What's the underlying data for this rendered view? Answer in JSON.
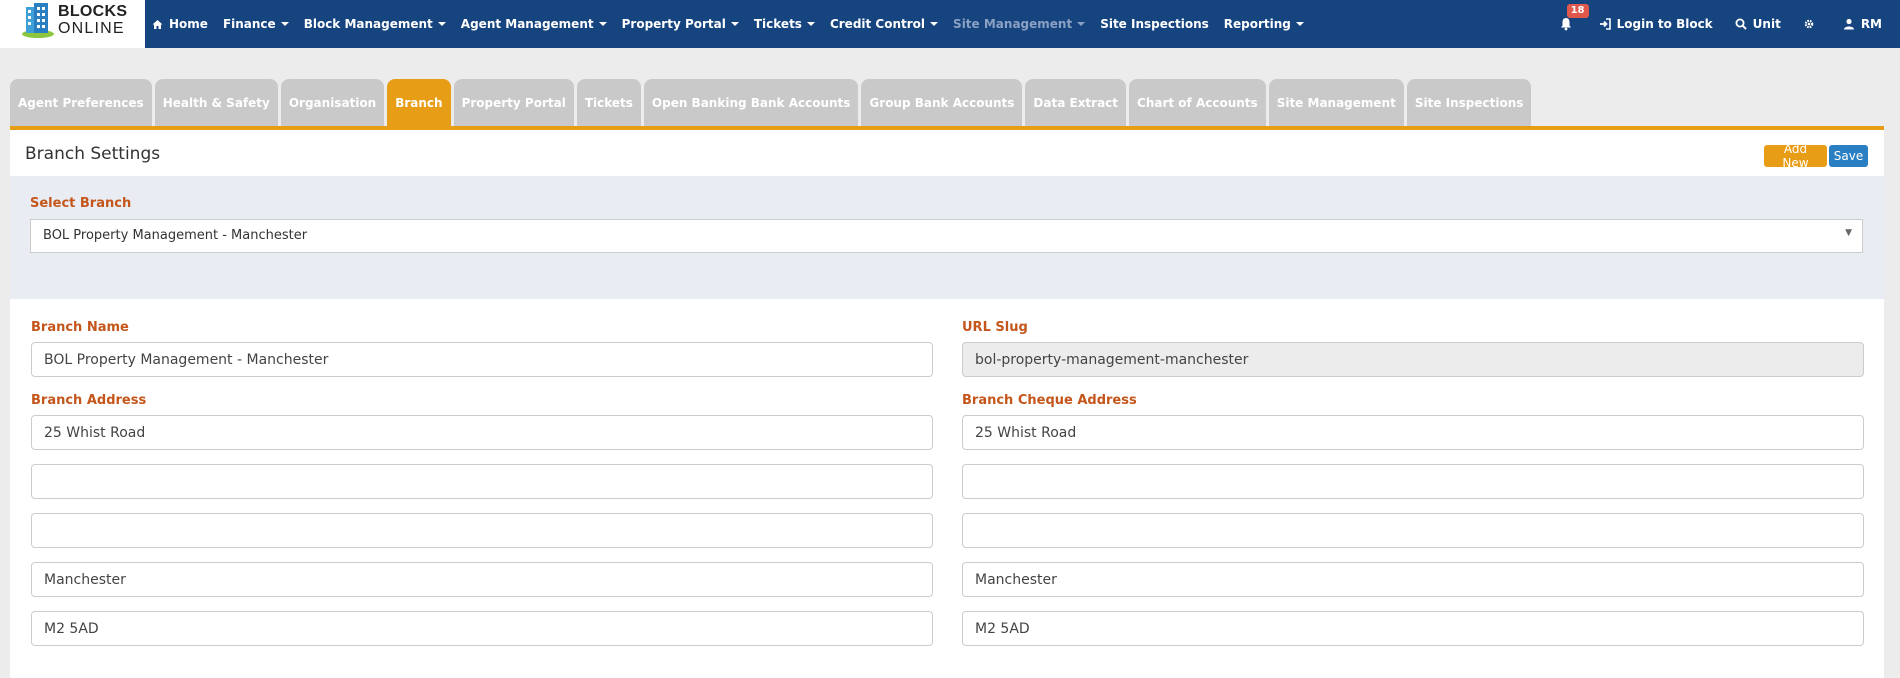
{
  "brand": {
    "line1": "BLOCKS",
    "line2": "ONLINE"
  },
  "nav": {
    "items": [
      {
        "label": "Home",
        "icon": "home-icon",
        "dropdown": false,
        "muted": false
      },
      {
        "label": "Finance",
        "dropdown": true,
        "muted": false
      },
      {
        "label": "Block Management",
        "dropdown": true,
        "muted": false
      },
      {
        "label": "Agent Management",
        "dropdown": true,
        "muted": false
      },
      {
        "label": "Property Portal",
        "dropdown": true,
        "muted": false
      },
      {
        "label": "Tickets",
        "dropdown": true,
        "muted": false
      },
      {
        "label": "Credit Control",
        "dropdown": true,
        "muted": false
      },
      {
        "label": "Site Management",
        "dropdown": true,
        "muted": true
      },
      {
        "label": "Site Inspections",
        "dropdown": false,
        "muted": false
      },
      {
        "label": "Reporting",
        "dropdown": true,
        "muted": false
      }
    ]
  },
  "right_nav": {
    "notification_count": "18",
    "login_label": "Login to Block",
    "unit_label": "Unit",
    "user_initials": "RM"
  },
  "tabs": [
    {
      "label": "Agent Preferences",
      "active": false
    },
    {
      "label": "Health & Safety",
      "active": false
    },
    {
      "label": "Organisation",
      "active": false
    },
    {
      "label": "Branch",
      "active": true
    },
    {
      "label": "Property Portal",
      "active": false
    },
    {
      "label": "Tickets",
      "active": false
    },
    {
      "label": "Open Banking Bank Accounts",
      "active": false
    },
    {
      "label": "Group Bank Accounts",
      "active": false
    },
    {
      "label": "Data Extract",
      "active": false
    },
    {
      "label": "Chart of Accounts",
      "active": false
    },
    {
      "label": "Site Management",
      "active": false
    },
    {
      "label": "Site Inspections",
      "active": false
    }
  ],
  "panel": {
    "title": "Branch Settings",
    "add_new_label": "Add New",
    "save_label": "Save"
  },
  "branch_select": {
    "label": "Select Branch",
    "value": "BOL Property Management - Manchester"
  },
  "form": {
    "branch_name_label": "Branch Name",
    "branch_name": "BOL Property Management - Manchester",
    "url_slug_label": "URL Slug",
    "url_slug": "bol-property-management-manchester",
    "branch_address_label": "Branch Address",
    "branch_address": [
      "25 Whist Road",
      "",
      "",
      "Manchester",
      "M2 5AD"
    ],
    "cheque_address_label": "Branch Cheque Address",
    "cheque_address": [
      "25 Whist Road",
      "",
      "",
      "Manchester",
      "M2 5AD"
    ]
  },
  "colors": {
    "nav_bg": "#16447f",
    "tab_active": "#e89d16",
    "tab_inactive": "#c9c9c9",
    "label_orange": "#c4561b",
    "save_blue": "#2a7fc2"
  }
}
